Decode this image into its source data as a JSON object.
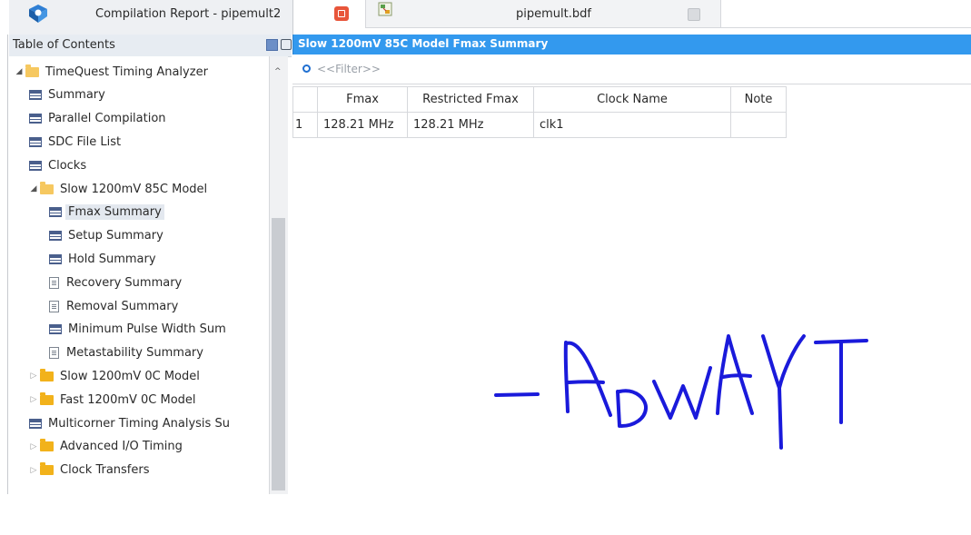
{
  "tabs": {
    "report_title": "Compilation Report - pipemult2",
    "bdf_title": "pipemult.bdf"
  },
  "toc": {
    "header": "Table of Contents",
    "items": [
      {
        "label": "TimeQuest Timing Analyzer",
        "icon": "folder-open-icon",
        "level": 0,
        "expanded": true
      },
      {
        "label": "Summary",
        "icon": "table-icon",
        "level": 1
      },
      {
        "label": "Parallel Compilation",
        "icon": "table-icon",
        "level": 1
      },
      {
        "label": "SDC File List",
        "icon": "table-icon",
        "level": 1
      },
      {
        "label": "Clocks",
        "icon": "table-icon",
        "level": 1
      },
      {
        "label": "Slow 1200mV 85C Model",
        "icon": "folder-open-icon",
        "level": 1,
        "expanded": true
      },
      {
        "label": "Fmax Summary",
        "icon": "table-icon",
        "level": 2,
        "selected": true
      },
      {
        "label": "Setup Summary",
        "icon": "table-icon",
        "level": 2
      },
      {
        "label": "Hold Summary",
        "icon": "table-icon",
        "level": 2
      },
      {
        "label": "Recovery Summary",
        "icon": "document-icon",
        "level": 2
      },
      {
        "label": "Removal Summary",
        "icon": "document-icon",
        "level": 2
      },
      {
        "label": "Minimum Pulse Width Sum",
        "icon": "table-icon",
        "level": 2
      },
      {
        "label": "Metastability Summary",
        "icon": "document-icon",
        "level": 2
      },
      {
        "label": "Slow 1200mV 0C Model",
        "icon": "folder-icon",
        "level": 1,
        "expanded": false
      },
      {
        "label": "Fast 1200mV 0C Model",
        "icon": "folder-icon",
        "level": 1,
        "expanded": false
      },
      {
        "label": "Multicorner Timing Analysis Su",
        "icon": "table-icon",
        "level": 1
      },
      {
        "label": "Advanced I/O Timing",
        "icon": "folder-icon",
        "level": 1,
        "expanded": false
      },
      {
        "label": "Clock Transfers",
        "icon": "folder-icon",
        "level": 1,
        "expanded": false
      }
    ]
  },
  "report": {
    "title": "Slow 1200mV 85C Model Fmax Summary",
    "filter_placeholder": "<<Filter>>",
    "columns": [
      "",
      "Fmax",
      "Restricted Fmax",
      "Clock Name",
      "Note"
    ],
    "rows": [
      [
        "1",
        "128.21 MHz",
        "128.21 MHz",
        "clk1",
        ""
      ]
    ]
  },
  "annotation": {
    "text": "-ADWAYT",
    "color": "#1a1adb"
  }
}
